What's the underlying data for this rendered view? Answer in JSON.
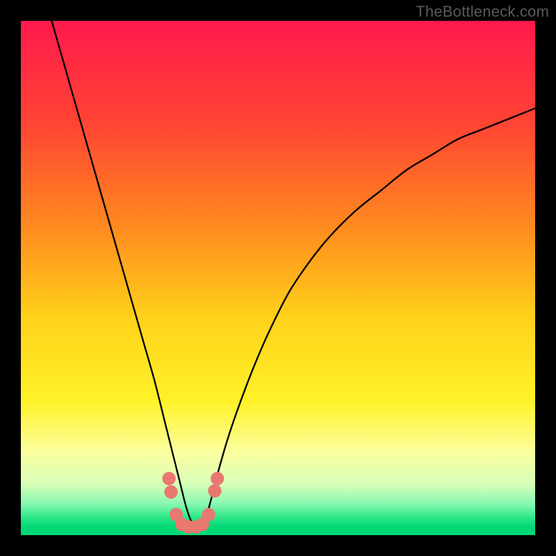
{
  "watermark": "TheBottleneck.com",
  "colors": {
    "frame": "#000000",
    "gradient_stops": [
      {
        "pos": 0.0,
        "color": "#ff1a4d"
      },
      {
        "pos": 0.2,
        "color": "#ff4433"
      },
      {
        "pos": 0.4,
        "color": "#ff8a1f"
      },
      {
        "pos": 0.58,
        "color": "#ffd21a"
      },
      {
        "pos": 0.74,
        "color": "#fff229"
      },
      {
        "pos": 0.84,
        "color": "#fbffa0"
      },
      {
        "pos": 0.9,
        "color": "#d8ffb8"
      },
      {
        "pos": 0.94,
        "color": "#86f8b0"
      },
      {
        "pos": 0.965,
        "color": "#2ee88a"
      },
      {
        "pos": 0.985,
        "color": "#00d877"
      },
      {
        "pos": 1.0,
        "color": "#00d877"
      }
    ],
    "curve": "#000000",
    "marker": "#e87870"
  },
  "chart_data": {
    "type": "line",
    "title": "",
    "xlabel": "",
    "ylabel": "",
    "xlim": [
      0,
      100
    ],
    "ylim": [
      0,
      100
    ],
    "grid": false,
    "series": [
      {
        "name": "bottleneck-curve",
        "x": [
          6,
          8,
          10,
          12,
          14,
          16,
          18,
          20,
          22,
          24,
          26,
          28,
          29,
          30,
          31,
          32,
          33,
          34,
          35,
          36,
          37,
          38,
          40,
          42,
          45,
          48,
          52,
          56,
          60,
          65,
          70,
          75,
          80,
          85,
          90,
          95,
          100
        ],
        "y": [
          100,
          93,
          86,
          79,
          72,
          65,
          58,
          51,
          44,
          37,
          30,
          22,
          18,
          14,
          10,
          6,
          3,
          1.5,
          1.5,
          3.5,
          7,
          11,
          18,
          24,
          32,
          39,
          47,
          53,
          58,
          63,
          67,
          71,
          74,
          77,
          79,
          81,
          83
        ]
      }
    ],
    "markers": {
      "name": "threshold-dots",
      "points": [
        {
          "x": 28.8,
          "y": 11.0
        },
        {
          "x": 29.2,
          "y": 8.4
        },
        {
          "x": 30.2,
          "y": 4.0
        },
        {
          "x": 31.3,
          "y": 2.1
        },
        {
          "x": 32.6,
          "y": 1.6
        },
        {
          "x": 34.0,
          "y": 1.6
        },
        {
          "x": 35.3,
          "y": 2.1
        },
        {
          "x": 36.5,
          "y": 4.0
        },
        {
          "x": 37.7,
          "y": 8.6
        },
        {
          "x": 38.2,
          "y": 11.0
        }
      ],
      "radius": 1.3
    }
  }
}
